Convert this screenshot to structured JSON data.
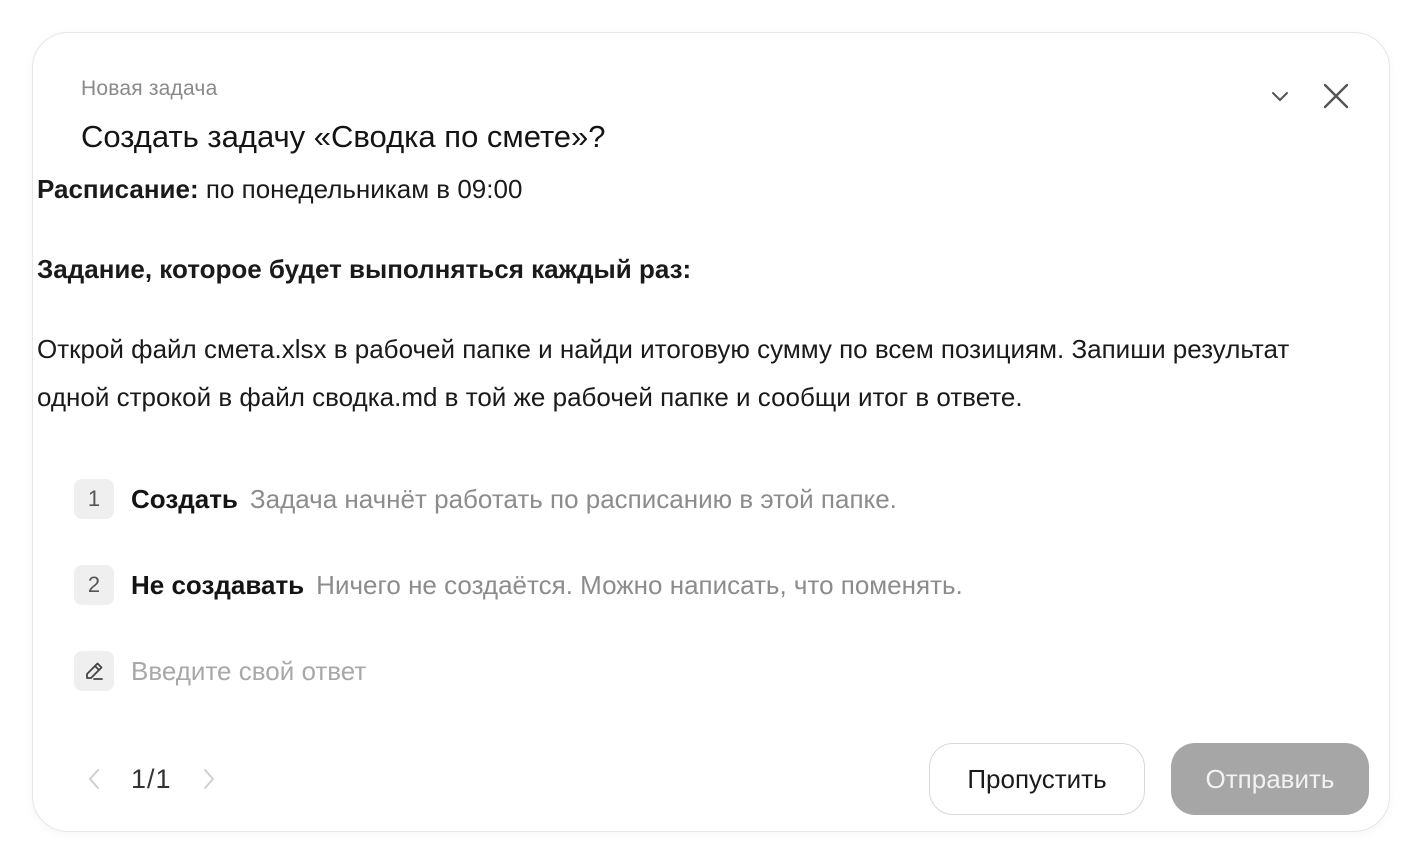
{
  "header": {
    "eyebrow": "Новая задача",
    "title": "Создать задачу «Сводка по смете»?",
    "icons": [
      "chevron-down-icon",
      "close-icon"
    ]
  },
  "body": {
    "schedule_label": "Расписание:",
    "schedule_value": " по понедельникам в 09:00",
    "task_heading": "Задание, которое будет выполняться каждый раз:",
    "task_text": "Открой файл смета.xlsx в рабочей папке и найди итоговую сумму по всем позициям. Запиши результат одной строкой в файл сводка.md в той же рабочей папке и сообщи итог в ответе."
  },
  "options": [
    {
      "number": "1",
      "label": "Создать",
      "description": "Задача начнёт работать по расписанию в этой папке."
    },
    {
      "number": "2",
      "label": "Не создавать",
      "description": "Ничего не создаётся. Можно написать, что поменять."
    }
  ],
  "answer": {
    "placeholder": "Введите свой ответ",
    "value": "",
    "icon": "pencil-icon"
  },
  "footer": {
    "pager": "1/1",
    "skip_label": "Пропустить",
    "send_label": "Отправить"
  },
  "colors": {
    "send_button_bg": "#a6a6a6",
    "muted_text": "#8c8c8c",
    "badge_bg": "#efefef"
  }
}
